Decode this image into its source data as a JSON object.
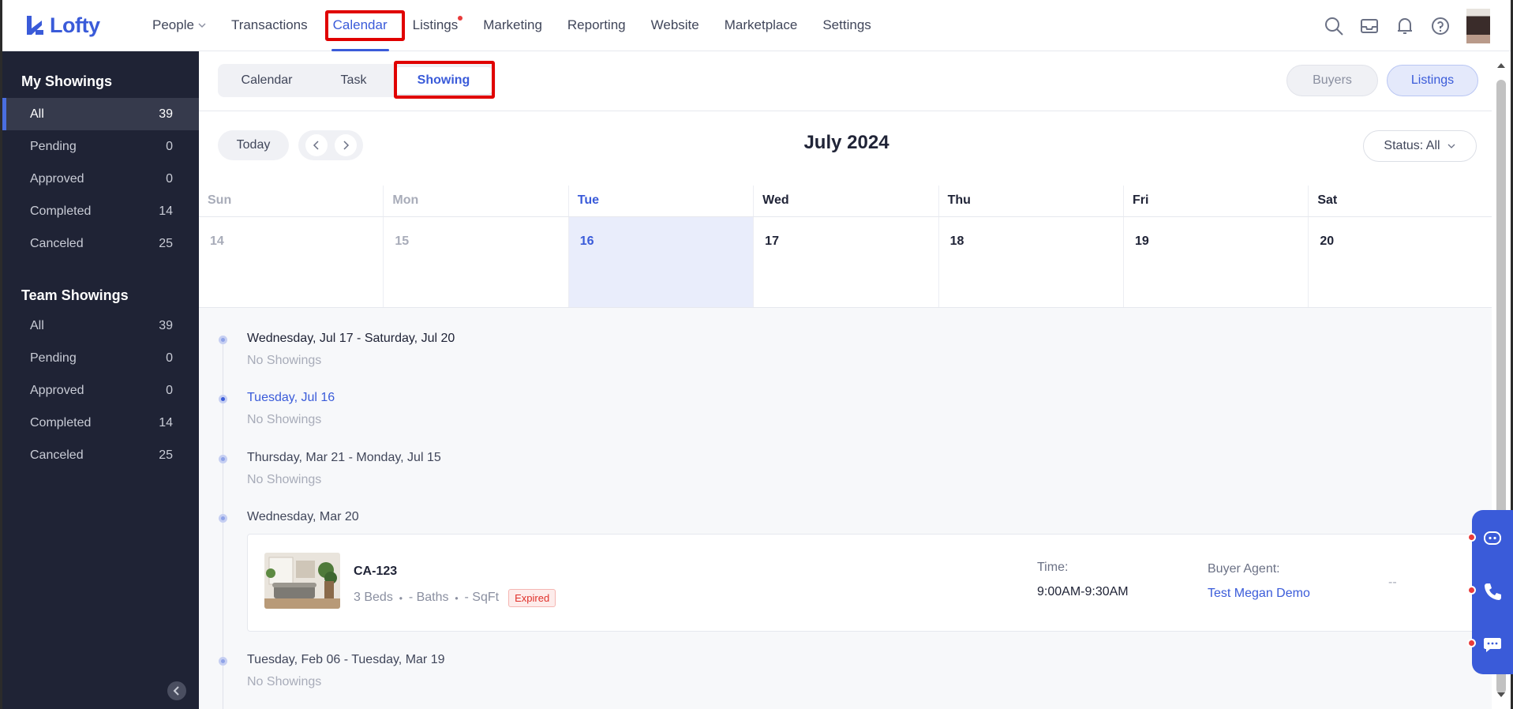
{
  "logo": {
    "text": "Lofty"
  },
  "nav": {
    "items": [
      {
        "label": "People",
        "has_dropdown": true
      },
      {
        "label": "Transactions"
      },
      {
        "label": "Calendar",
        "active": true
      },
      {
        "label": "Listings",
        "has_dot": true
      },
      {
        "label": "Marketing"
      },
      {
        "label": "Reporting"
      },
      {
        "label": "Website"
      },
      {
        "label": "Marketplace"
      },
      {
        "label": "Settings"
      }
    ],
    "right_icons": [
      "search-icon",
      "inbox-icon",
      "bell-icon",
      "help-icon",
      "avatar"
    ]
  },
  "sidebar": {
    "my_showings": {
      "title": "My Showings",
      "items": [
        {
          "label": "All",
          "count": "39"
        },
        {
          "label": "Pending",
          "count": "0"
        },
        {
          "label": "Approved",
          "count": "0"
        },
        {
          "label": "Completed",
          "count": "14"
        },
        {
          "label": "Canceled",
          "count": "25"
        }
      ]
    },
    "team_showings": {
      "title": "Team Showings",
      "items": [
        {
          "label": "All",
          "count": "39"
        },
        {
          "label": "Pending",
          "count": "0"
        },
        {
          "label": "Approved",
          "count": "0"
        },
        {
          "label": "Completed",
          "count": "14"
        },
        {
          "label": "Canceled",
          "count": "25"
        }
      ]
    }
  },
  "tabs": {
    "items": [
      "Calendar",
      "Task",
      "Showing"
    ],
    "active": "Showing"
  },
  "view_toggle": {
    "buyers": "Buyers",
    "listings": "Listings"
  },
  "toolbar": {
    "today": "Today",
    "month": "July 2024",
    "status": "Status: All"
  },
  "week": {
    "days": [
      "Sun",
      "Mon",
      "Tue",
      "Wed",
      "Thu",
      "Fri",
      "Sat"
    ],
    "dates": [
      "14",
      "15",
      "16",
      "17",
      "18",
      "19",
      "20"
    ]
  },
  "agenda": [
    {
      "range": "Wednesday, Jul 17 - Saturday, Jul 20",
      "empty": "No Showings"
    },
    {
      "range": "Tuesday, Jul 16",
      "empty": "No Showings"
    },
    {
      "range": "Thursday, Mar 21 - Monday, Jul 15",
      "empty": "No Showings"
    },
    {
      "range": "Wednesday, Mar 20"
    },
    {
      "range": "Tuesday, Feb 06 - Tuesday, Mar 19",
      "empty": "No Showings"
    }
  ],
  "showing": {
    "title": "CA-123",
    "beds": "3 Beds",
    "baths": "- Baths",
    "sqft": "- SqFt",
    "sep": "・",
    "badge": "Expired",
    "time_label": "Time:",
    "time_value": "9:00AM-9:30AM",
    "agent_label": "Buyer Agent:",
    "agent_value": "Test Megan Demo",
    "extra": "--"
  },
  "colors": {
    "accent": "#3a5bd9",
    "sidebar_bg": "#1f2335",
    "highlight": "#e00000",
    "badge_red": "#e0302a"
  }
}
